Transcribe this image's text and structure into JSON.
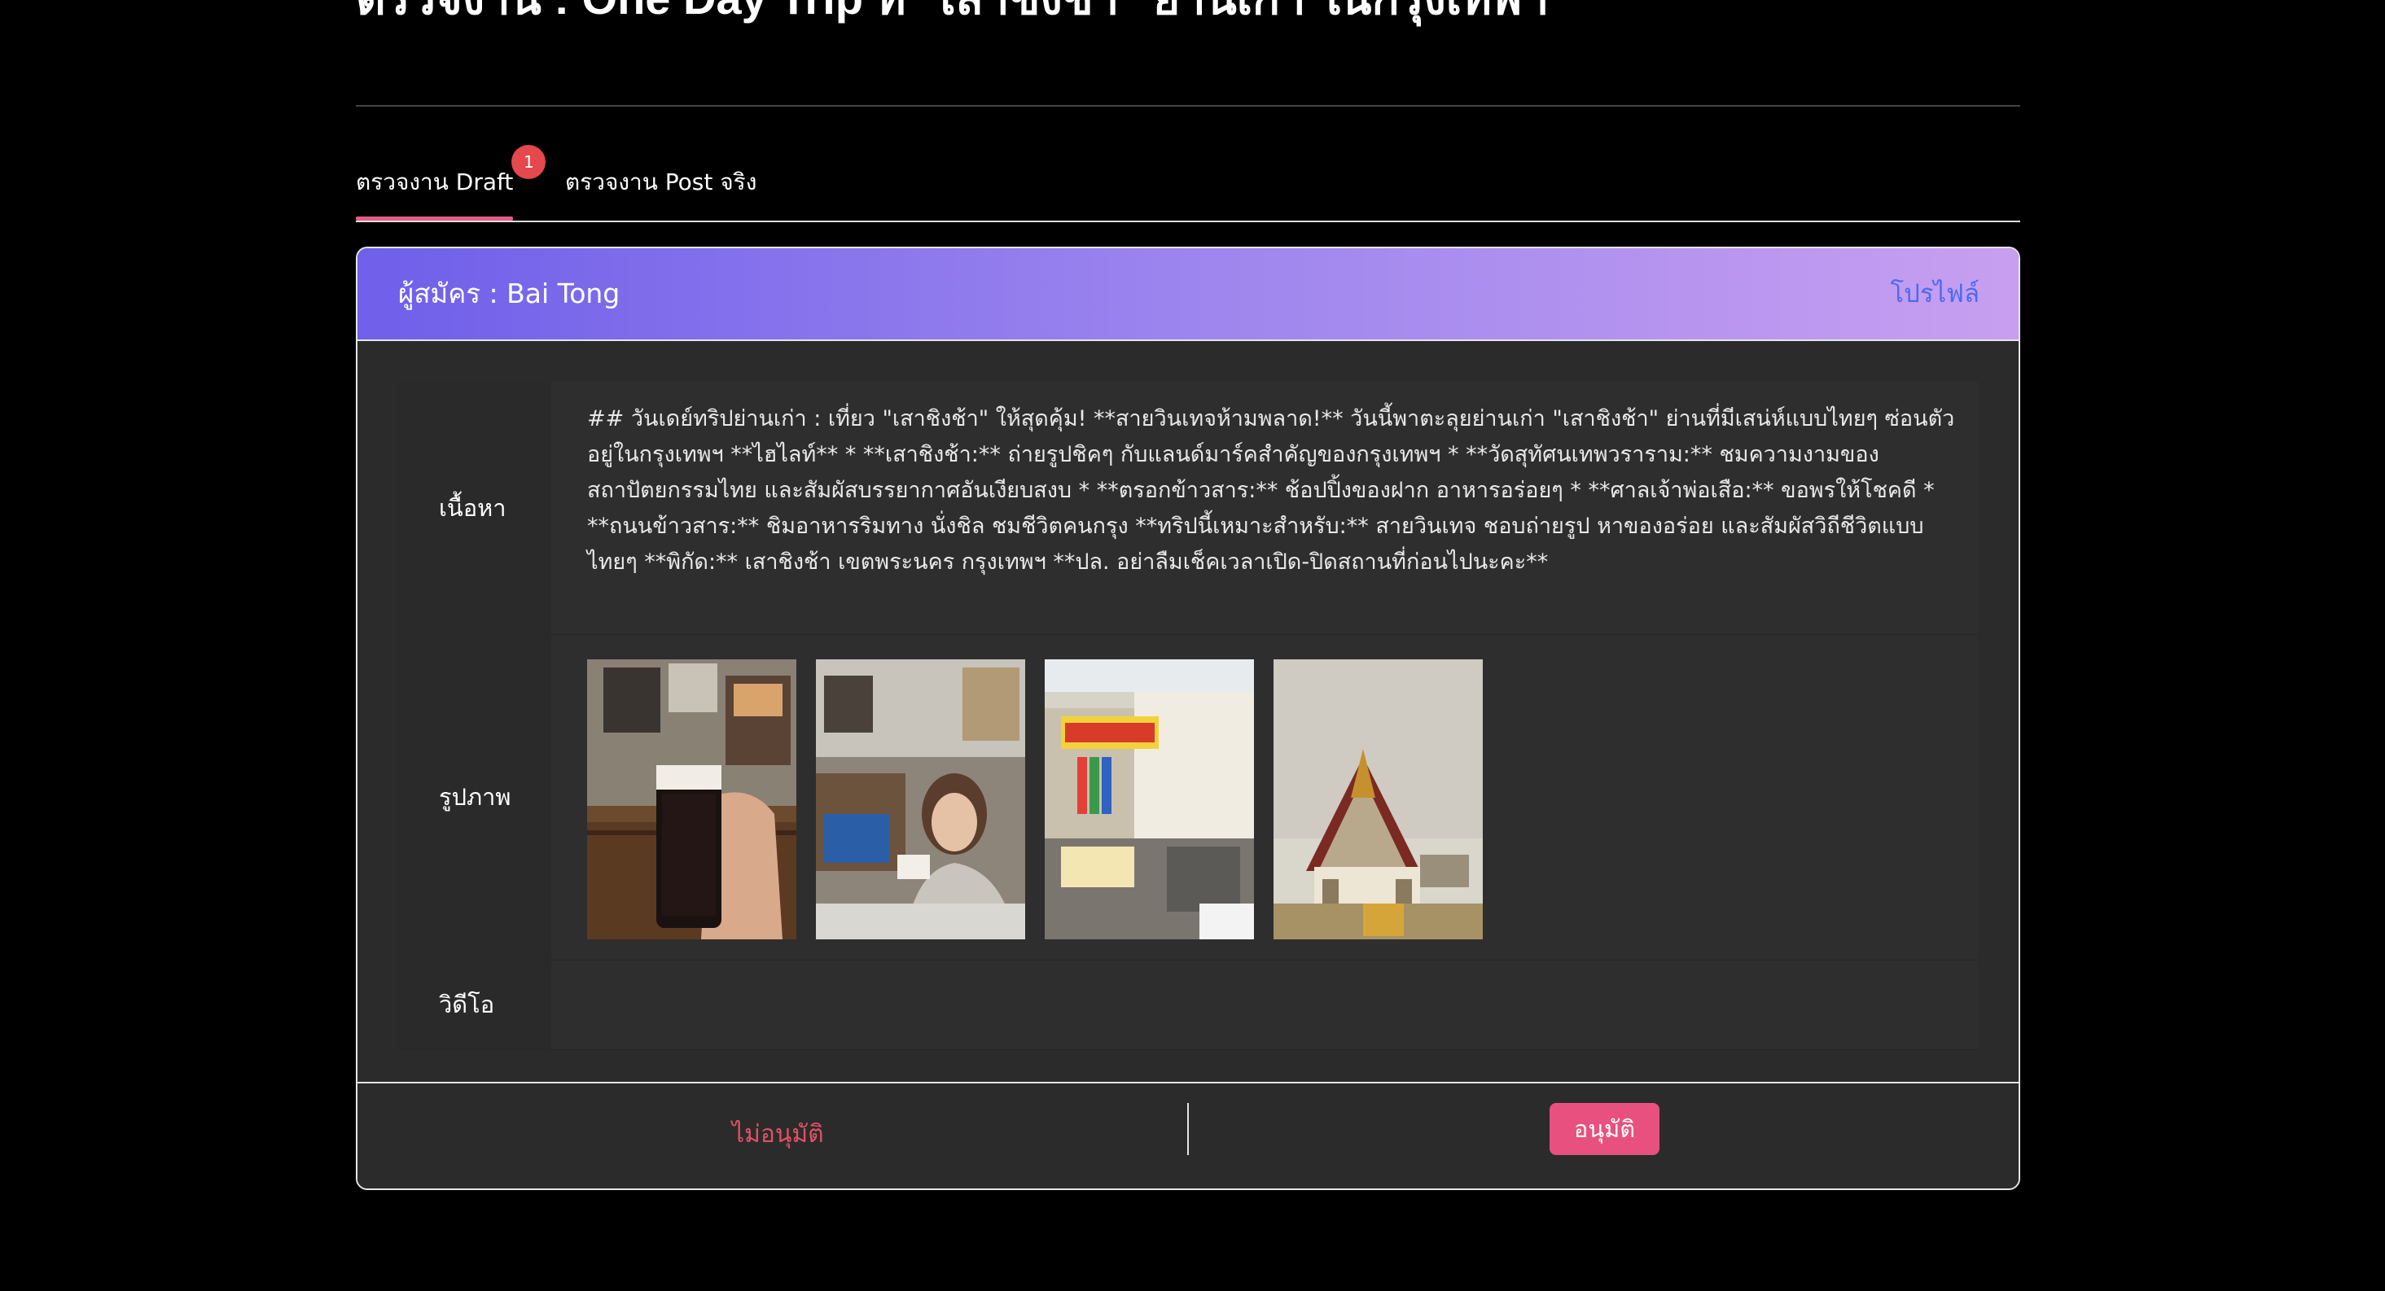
{
  "page": {
    "title": "ตรวจงาน : One Day Trip ที่ \"เสาชิงช้า\" ย่านเก่า ในกรุงเทพฯ"
  },
  "tabs": [
    {
      "label": "ตรวจงาน Draft",
      "badge": "1",
      "active": true
    },
    {
      "label": "ตรวจงาน Post จริง",
      "active": false
    }
  ],
  "card": {
    "applicant": "ผู้สมัคร : Bai Tong",
    "profile_link": "โปรไฟล์",
    "header_gradient": [
      "#6f5fea",
      "#c89ff0"
    ],
    "rows": {
      "content_label": "เนื้อหา",
      "content_text": "## วันเดย์ทริปย่านเก่า : เที่ยว \"เสาชิงช้า\" ให้สุดคุ้ม! **สายวินเทจห้ามพลาด!** วันนี้พาตะลุยย่านเก่า \"เสาชิงช้า\" ย่านที่มีเสน่ห์แบบไทยๆ ซ่อนตัวอยู่ในกรุงเทพฯ **ไฮไลท์** * **เสาชิงช้า:** ถ่ายรูปชิคๆ กับแลนด์มาร์คสำคัญของกรุงเทพฯ * **วัดสุทัศนเทพวราราม:** ชมความงามของสถาปัตยกรรมไทย และสัมผัสบรรยากาศอันเงียบสงบ * **ตรอกข้าวสาร:** ช้อปปิ้งของฝาก อาหารอร่อยๆ * **ศาลเจ้าพ่อเสือ:** ขอพรให้โชคดี * **ถนนข้าวสาร:** ชิมอาหารริมทาง นั่งชิล ชมชีวิตคนกรุง **ทริปนี้เหมาะสำหรับ:** สายวินเทจ ชอบถ่ายรูป หาของอร่อย และสัมผัสวิถีชีวิตแบบไทยๆ **พิกัด:** เสาชิงช้า เขตพระนคร กรุงเทพฯ **ปล. อย่าลืมเช็คเวลาเปิด-ปิดสถานที่ก่อนไปนะคะ**",
      "images_label": "รูปภาพ",
      "images": [
        {
          "name": "photo-iced-drink",
          "subject": "hand holding glass of dark iced drink in cafe"
        },
        {
          "name": "photo-woman-cafe",
          "subject": "woman drinking in a shop"
        },
        {
          "name": "photo-shophouse",
          "subject": "street shophouse with colorful sign"
        },
        {
          "name": "photo-temple",
          "subject": "thai temple roof against sky"
        }
      ],
      "video_label": "วิดีโอ"
    }
  },
  "footer": {
    "reject_label": "ไม่อนุมัติ",
    "approve_label": "อนุมัติ"
  },
  "colors": {
    "accent_pink": "#e8517f",
    "reject_red": "#e05263",
    "link_blue": "#4a6bf2",
    "badge_red": "#e5484d"
  }
}
